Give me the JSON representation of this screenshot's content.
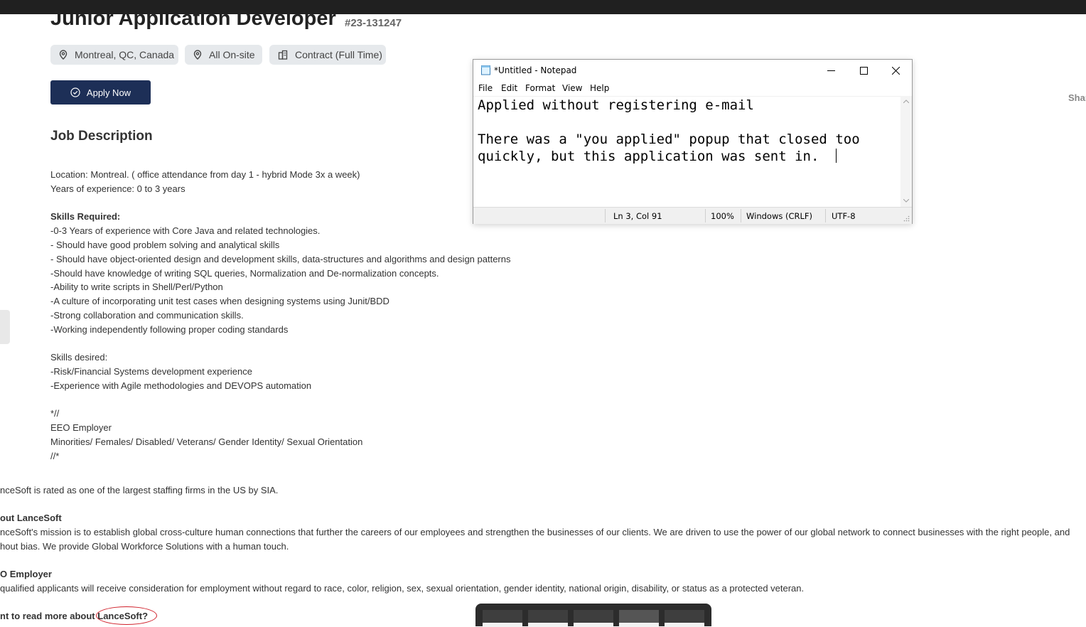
{
  "job": {
    "title": "Junior Application Developer",
    "id": "#23-131247",
    "tags": {
      "location": "Montreal, QC, Canada",
      "workplace": "All On-site",
      "type": "Contract (Full Time)"
    },
    "apply_label": "Apply Now",
    "share_label": "Shar",
    "description_heading": "Job Description",
    "lines": [
      "Location: Montreal. ( office attendance from day 1 - hybrid Mode 3x a week)",
      "Years of experience: 0 to 3 years",
      "Skills Required:",
      "-0-3 Years of experience with Core Java and related technologies.",
      "- Should have good problem solving and analytical skills",
      "- Should have object-oriented design and development skills, data-structures and algorithms and design patterns",
      "-Should have knowledge of writing SQL queries, Normalization and De-normalization concepts.",
      "-Ability to write scripts in Shell/Perl/Python",
      "-A culture of incorporating unit test cases when designing systems using Junit/BDD",
      "-Strong collaboration and communication skills.",
      "-Working independently following proper coding standards",
      "Skills desired:",
      "-Risk/Financial Systems development experience",
      "-Experience with Agile methodologies and DEVOPS automation",
      "*//",
      "EEO Employer",
      "Minorities/ Females/ Disabled/ Veterans/ Gender Identity/ Sexual Orientation",
      "//*"
    ]
  },
  "company": {
    "rating_line": "nceSoft is rated as one of the largest staffing firms in the US by SIA.",
    "about_heading": "out LanceSoft",
    "mission_line1": "nceSoft's mission is to establish global cross-culture human connections that further the careers of our employees and strengthen the businesses of our clients. We are driven to use the power of our global network to connect businesses with the right people, and",
    "mission_line2": "hout bias. We provide Global Workforce Solutions with a human touch.",
    "eeo_heading": "O Employer",
    "eeo_line": "qualified applicants will receive consideration for employment without regard to race, color, religion, sex, sexual orientation, gender identity, national origin, disability, or status as a protected veteran.",
    "read_more_prefix": "nt to read more about",
    "read_more_link": "LanceSoft?"
  },
  "notepad": {
    "title": "*Untitled - Notepad",
    "menu": [
      "File",
      "Edit",
      "Format",
      "View",
      "Help"
    ],
    "text_lines": [
      "Applied without registering e-mail",
      "",
      "There was a \"you applied\" popup that closed too",
      "quickly, but this application was sent in."
    ],
    "status": {
      "position": "Ln 3, Col 91",
      "zoom": "100%",
      "line_ending": "Windows (CRLF)",
      "encoding": "UTF-8"
    }
  },
  "colors": {
    "apply_button": "#1d2f57",
    "tag_background": "#e6e9ec",
    "annotation_circle": "#d0202a"
  }
}
